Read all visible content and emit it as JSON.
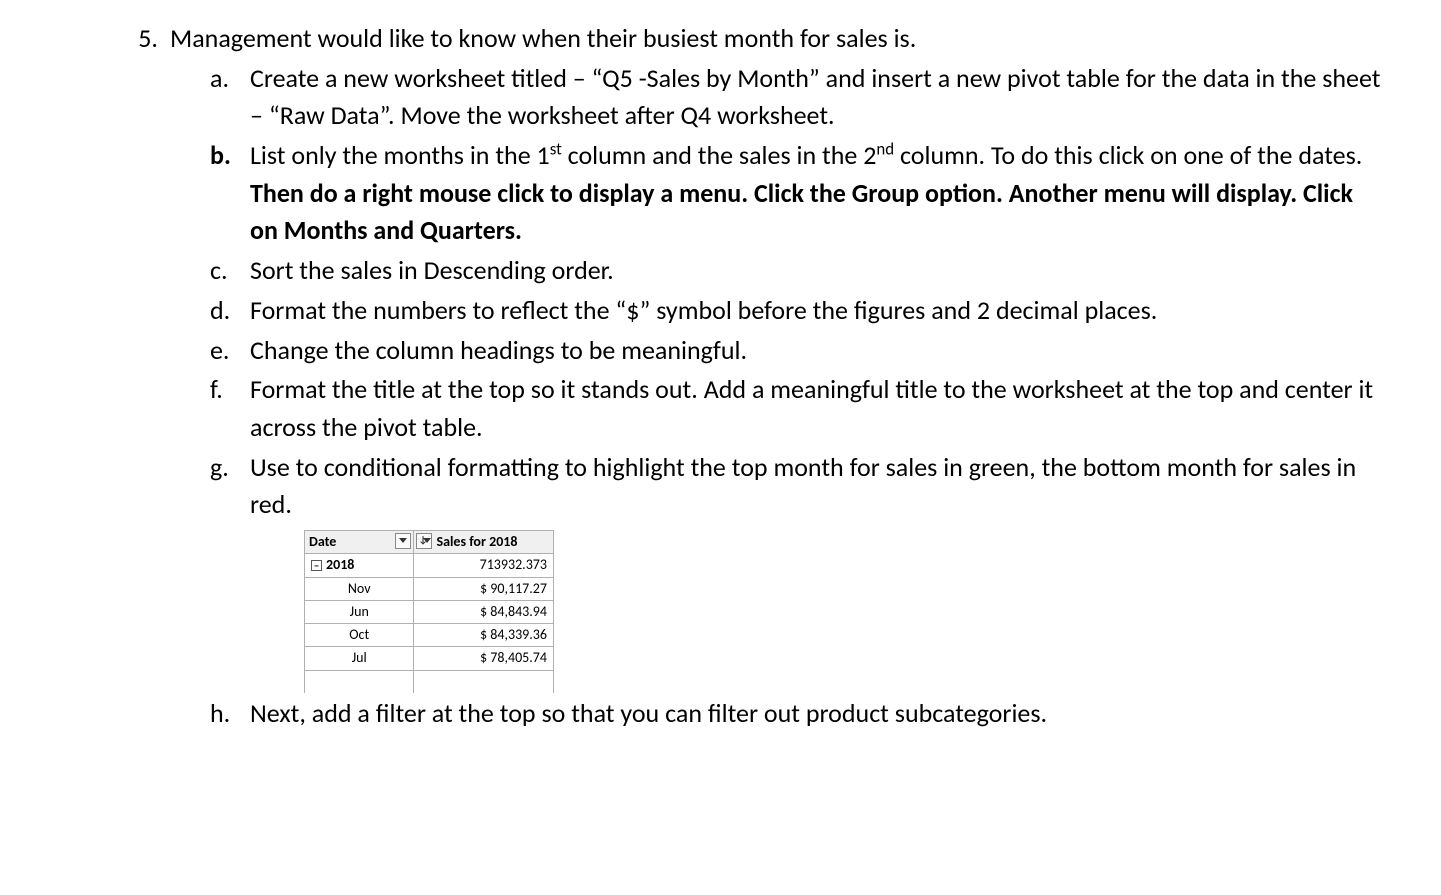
{
  "question": {
    "number": "5.",
    "intro": "Management would like to know when their busiest month for sales is.",
    "items": {
      "a": {
        "marker": "a.",
        "text": "Create a new worksheet titled – “Q5 -Sales by Month” and insert a new pivot table for the data in the sheet – “Raw Data”.  Move the worksheet after Q4 worksheet."
      },
      "b": {
        "marker": "b.",
        "part1": "List only the months in the 1",
        "sup1": "st",
        "part2": " column and the sales in the 2",
        "sup2": "nd",
        "part3": " column.  To do this click on one of the dates.  ",
        "bold": "Then do a right mouse click to display a menu.  Click the Group option.  Another menu will display.  Click on Months and Quarters."
      },
      "c": {
        "marker": "c.",
        "text": "Sort the sales in Descending order."
      },
      "d": {
        "marker": "d.",
        "text": "Format the numbers to reflect the “$” symbol before the figures and 2 decimal places."
      },
      "e": {
        "marker": "e.",
        "text": "Change the column headings to be meaningful."
      },
      "f": {
        "marker": "f.",
        "text": "Format the title at the top so it stands out.  Add a meaningful title to the worksheet at the top and center it across the pivot table."
      },
      "g": {
        "marker": "g.",
        "text": "Use to conditional formatting to highlight the top month for sales in green, the bottom month for sales in red."
      },
      "h": {
        "marker": "h.",
        "text": "Next, add a filter at the top so that you can filter out product subcategories."
      }
    }
  },
  "pivot": {
    "headers": {
      "date": "Date",
      "sales": "Sales for 2018"
    },
    "expand_glyph": "−",
    "year_row": {
      "label": "2018",
      "value": "713932.373"
    },
    "rows": [
      {
        "month": "Nov",
        "value": "$  90,117.27"
      },
      {
        "month": "Jun",
        "value": "$  84,843.94"
      },
      {
        "month": "Oct",
        "value": "$  84,339.36"
      },
      {
        "month": "Jul",
        "value": "$  78,405.74"
      }
    ]
  }
}
